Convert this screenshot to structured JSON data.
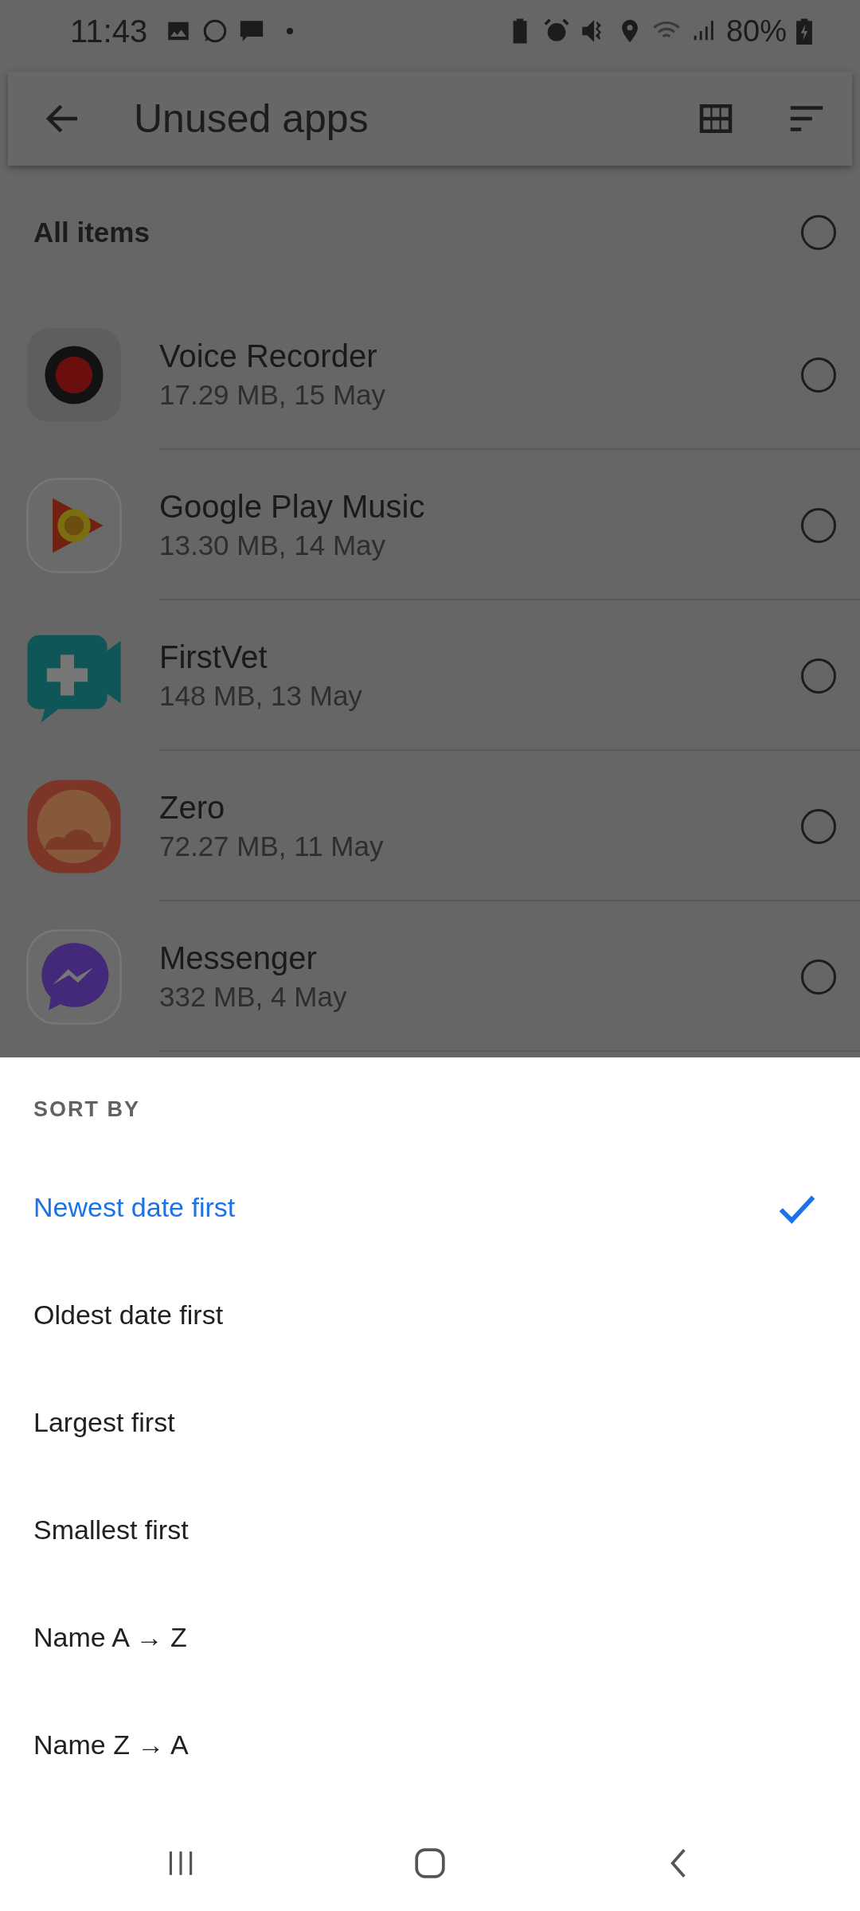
{
  "status_bar": {
    "time": "11:43",
    "battery": "80%"
  },
  "app_bar": {
    "title": "Unused apps"
  },
  "all_items": {
    "label": "All items",
    "checked": false
  },
  "apps": [
    {
      "kind": "recorder",
      "name": "Voice Recorder",
      "detail": "17.29 MB, 15 May",
      "checked": false
    },
    {
      "kind": "music",
      "name": "Google Play Music",
      "detail": "13.30 MB, 14 May",
      "checked": false
    },
    {
      "kind": "vet",
      "name": "FirstVet",
      "detail": "148 MB, 13 May",
      "checked": false
    },
    {
      "kind": "sunset",
      "name": "Zero",
      "detail": "72.27 MB, 11 May",
      "checked": false
    },
    {
      "kind": "messenger",
      "name": "Messenger",
      "detail": "332 MB, 4 May",
      "checked": false
    }
  ],
  "sort_sheet": {
    "title": "SORT BY",
    "options": [
      {
        "label": "Newest date first",
        "selected": true
      },
      {
        "label": "Oldest date first",
        "selected": false
      },
      {
        "label": "Largest first",
        "selected": false
      },
      {
        "label": "Smallest first",
        "selected": false
      },
      {
        "label": "Name A → Z",
        "selected": false
      },
      {
        "label": "Name Z → A",
        "selected": false
      }
    ]
  }
}
